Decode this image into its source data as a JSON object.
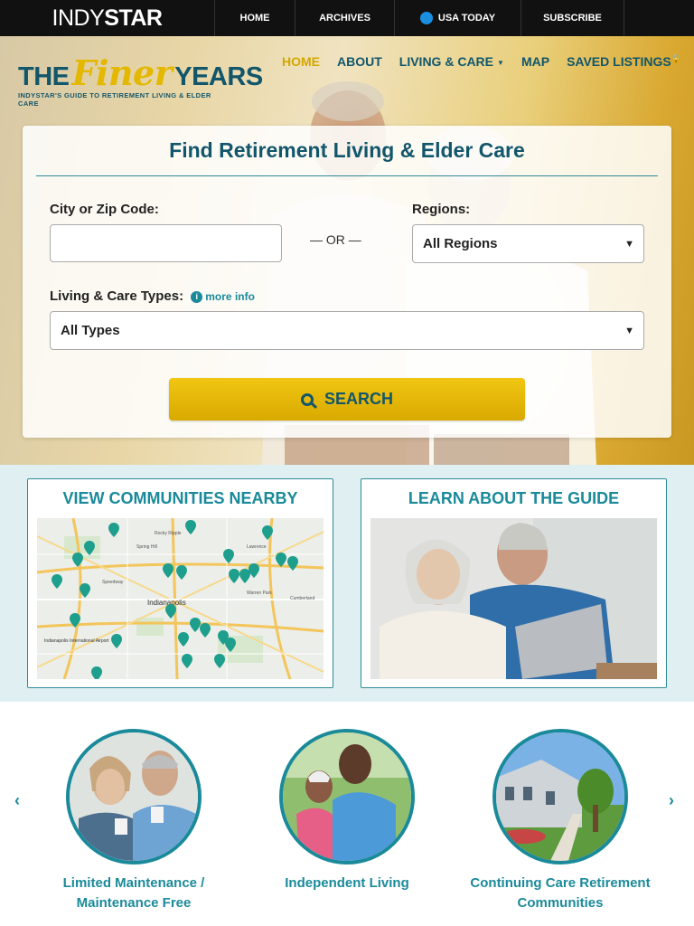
{
  "topbar": {
    "brand_thin": "INDY",
    "brand_bold": "STAR",
    "home": "HOME",
    "archives": "ARCHIVES",
    "usatoday": "USA TODAY",
    "subscribe": "SUBSCRIBE"
  },
  "logo": {
    "the": "THE",
    "finer": "Finer",
    "years": "YEARS",
    "tagline": "INDYSTAR'S GUIDE TO RETIREMENT LIVING & ELDER CARE"
  },
  "nav": {
    "home": "HOME",
    "about": "ABOUT",
    "living_care": "LIVING & CARE",
    "map": "MAP",
    "saved": "SAVED LISTINGS"
  },
  "search": {
    "title": "Find Retirement Living & Elder Care",
    "city_label": "City or Zip Code:",
    "city_value": "",
    "or": "OR",
    "regions_label": "Regions:",
    "regions_value": "All Regions",
    "types_label": "Living & Care Types:",
    "more_info": "more info",
    "types_value": "All Types",
    "button": "SEARCH"
  },
  "features": {
    "nearby_title": "VIEW COMMUNITIES NEARBY",
    "guide_title": "LEARN ABOUT THE GUIDE",
    "map_city": "Indianapolis",
    "map_airport": "Indianapolis International Airport",
    "map_places": [
      "Rocky Ripple",
      "Spring Hill",
      "Lawrence",
      "Speedway",
      "Warren Park",
      "Cumberland"
    ]
  },
  "carousel": {
    "items": [
      {
        "title_line1": "Limited Maintenance /",
        "title_line2": "Maintenance Free"
      },
      {
        "title_line1": "Independent Living",
        "title_line2": ""
      },
      {
        "title_line1": "Continuing Care Retirement",
        "title_line2": "Communities"
      }
    ],
    "prev": "‹",
    "next": "›"
  },
  "colors": {
    "accent_teal": "#1a8a9a",
    "dark_teal": "#12566b",
    "gold": "#e4b800"
  }
}
